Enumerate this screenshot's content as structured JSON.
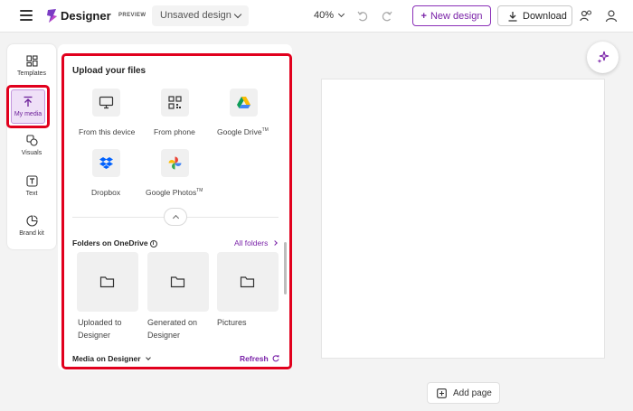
{
  "header": {
    "app_name": "Designer",
    "preview_badge": "PREVIEW",
    "design_name": "Unsaved design",
    "zoom": "40%",
    "new_design": "New design",
    "download": "Download"
  },
  "rail": {
    "items": [
      {
        "label": "Templates",
        "icon": "templates-icon"
      },
      {
        "label": "My media",
        "icon": "upload-icon",
        "active": true
      },
      {
        "label": "Visuals",
        "icon": "visuals-icon"
      },
      {
        "label": "Text",
        "icon": "text-icon"
      },
      {
        "label": "Brand kit",
        "icon": "brand-kit-icon"
      }
    ]
  },
  "panel": {
    "upload_title": "Upload your files",
    "sources": [
      {
        "label": "From this device",
        "icon": "monitor-icon"
      },
      {
        "label": "From phone",
        "icon": "qr-code-icon"
      },
      {
        "label": "Google Drive",
        "sup": "TM",
        "icon": "google-drive-icon"
      },
      {
        "label": "Dropbox",
        "icon": "dropbox-icon"
      },
      {
        "label": "Google Photos",
        "sup": "TM",
        "icon": "google-photos-icon"
      }
    ],
    "folders_title": "Folders on OneDrive",
    "all_folders": "All folders",
    "folders": [
      {
        "line1": "Uploaded to",
        "line2": "Designer"
      },
      {
        "line1": "Generated on",
        "line2": "Designer"
      },
      {
        "line1": "Pictures",
        "line2": ""
      }
    ],
    "media_title": "Media on Designer",
    "refresh": "Refresh"
  },
  "canvas": {
    "add_page": "Add page"
  },
  "colors": {
    "accent": "#7a22a8",
    "highlight": "#e1001d",
    "active_bg": "#efe0f7"
  }
}
